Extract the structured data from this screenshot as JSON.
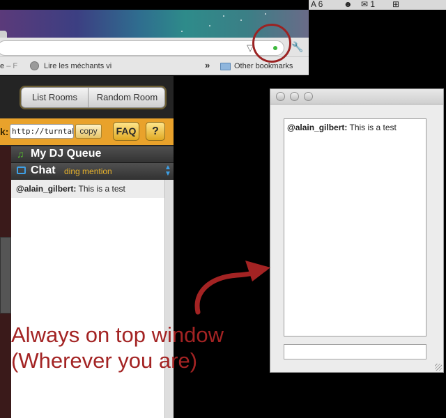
{
  "menubar": {
    "item1": "A 6",
    "item2": "☻",
    "item3": "✉ 1",
    "item4": "⊞"
  },
  "browser": {
    "bookmarks": {
      "item1_prefix": "e",
      "item1_suffix": "– F",
      "item2": "Lire les méchants vi",
      "overflow": "»",
      "other": "Other bookmarks"
    }
  },
  "room": {
    "list_rooms": "List Rooms",
    "random_room": "Random Room",
    "share_label": "k:",
    "share_url": "http://turntable.",
    "copy": "copy",
    "faq": "FAQ",
    "help": "?",
    "dj_queue": "My DJ Queue",
    "chat": "Chat",
    "ding": "ding mention",
    "messages": [
      {
        "user": "@alain_gilbert:",
        "text": " This is a test"
      }
    ]
  },
  "floating": {
    "messages": [
      {
        "user": "@alain_gilbert:",
        "text": " This is a test"
      }
    ],
    "input_value": ""
  },
  "annotation": {
    "line1": "Always on top window",
    "line2": "(Wherever you are)",
    "color": "#a32323"
  }
}
